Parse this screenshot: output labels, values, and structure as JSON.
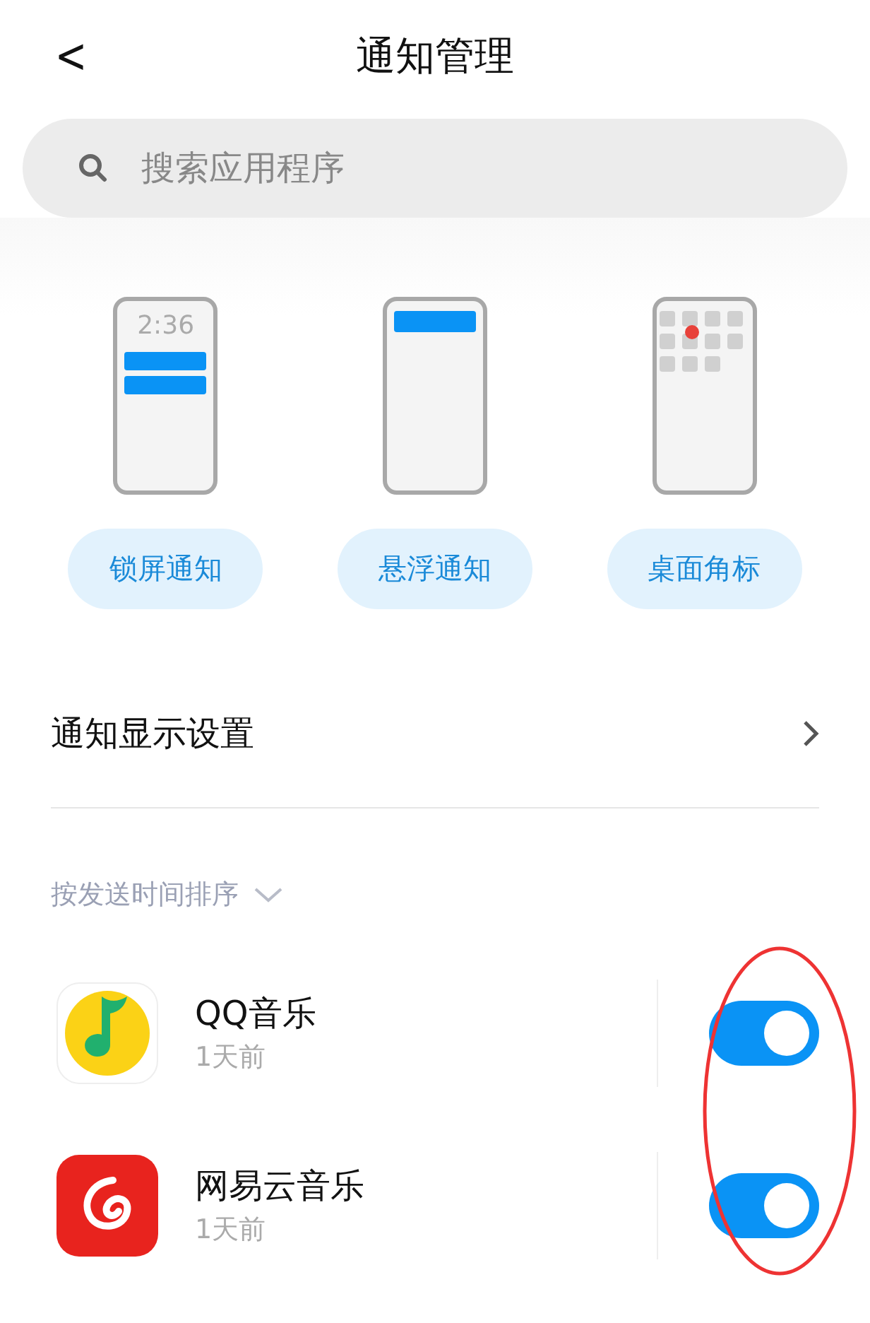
{
  "header": {
    "back": "<",
    "title": "通知管理"
  },
  "search": {
    "placeholder": "搜索应用程序"
  },
  "styles": [
    {
      "kind": "lockscreen",
      "clock": "2:36",
      "label": "锁屏通知"
    },
    {
      "kind": "floating",
      "label": "悬浮通知"
    },
    {
      "kind": "badge",
      "label": "桌面角标"
    }
  ],
  "display_settings": {
    "label": "通知显示设置"
  },
  "sort": {
    "label": "按发送时间排序"
  },
  "apps": [
    {
      "kind": "qq-music",
      "name": "QQ音乐",
      "time": "1天前",
      "on": true
    },
    {
      "kind": "netease",
      "name": "网易云音乐",
      "time": "1天前",
      "on": true
    }
  ]
}
